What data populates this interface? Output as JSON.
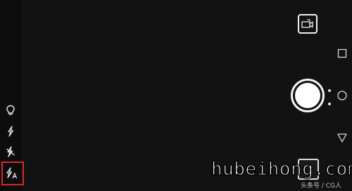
{
  "camera": {
    "left_controls": [
      {
        "name": "flash-always-on",
        "icon": "bulb-icon"
      },
      {
        "name": "flash-on",
        "icon": "flash-icon"
      },
      {
        "name": "flash-off",
        "icon": "flash-off-icon"
      },
      {
        "name": "flash-auto",
        "icon": "flash-auto-icon",
        "selected": true
      }
    ],
    "selection_color": "#d52a2a",
    "right_controls": {
      "switch_camera": "camera-switch-icon",
      "shutter": "shutter-button",
      "gallery": "gallery-thumbnail"
    },
    "mode_dots": 2
  },
  "nav": {
    "items": [
      "recent-apps-icon",
      "home-icon",
      "back-icon"
    ]
  },
  "watermark": {
    "text": "hubeihong.com"
  },
  "credit": {
    "text": "头条号 / CG人"
  }
}
